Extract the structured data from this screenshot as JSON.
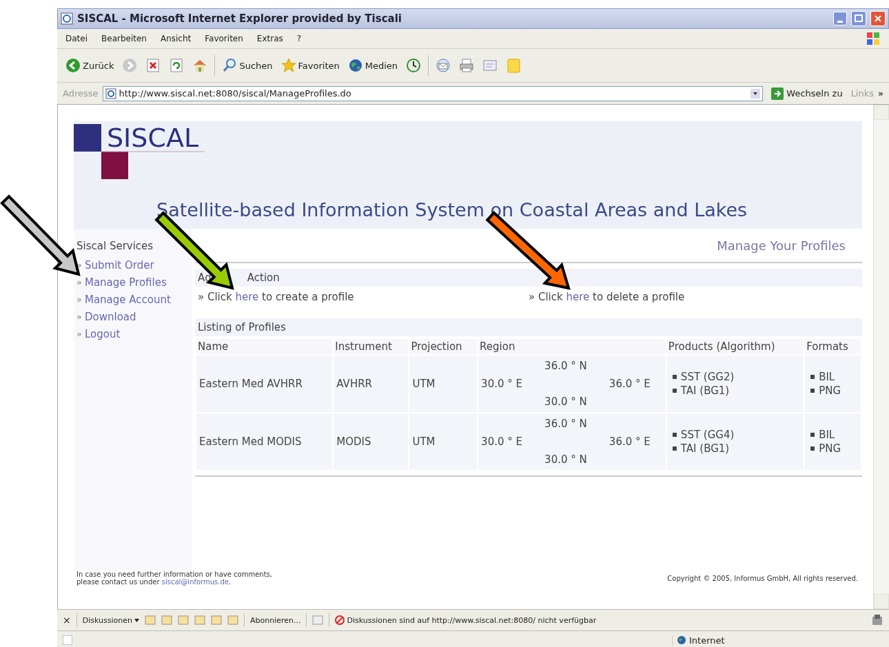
{
  "window": {
    "title": "SISCAL - Microsoft Internet Explorer provided by Tiscali"
  },
  "menu": [
    "Datei",
    "Bearbeiten",
    "Ansicht",
    "Favoriten",
    "Extras",
    "?"
  ],
  "toolbar": [
    {
      "kind": "back",
      "label": "Zurück"
    },
    {
      "kind": "forward"
    },
    {
      "kind": "stop"
    },
    {
      "kind": "refresh"
    },
    {
      "kind": "home"
    },
    {
      "kind": "search",
      "label": "Suchen"
    },
    {
      "kind": "favorites",
      "label": "Favoriten"
    },
    {
      "kind": "media",
      "label": "Medien"
    },
    {
      "kind": "history"
    },
    {
      "kind": "mail"
    },
    {
      "kind": "print"
    },
    {
      "kind": "edit"
    },
    {
      "kind": "note"
    }
  ],
  "address": {
    "label": "Adresse",
    "value": "http://www.siscal.net:8080/siscal/ManageProfiles.do",
    "go": "Wechseln zu",
    "links": "Links",
    "more": "»"
  },
  "page": {
    "logo": "SISCAL",
    "subtitle": "Satellite-based Information System on Coastal Areas and Lakes",
    "sidebar": {
      "heading": "Siscal Services",
      "items": [
        {
          "marker": "»",
          "label": "Submit Order"
        },
        {
          "marker": "»",
          "label": "Manage Profiles"
        },
        {
          "marker": "»",
          "label": "Manage Account"
        },
        {
          "marker": "»",
          "label": "Download"
        },
        {
          "marker": "»",
          "label": "Logout"
        }
      ]
    },
    "heading": "Manage Your Profiles",
    "action_heading": [
      "Ag",
      "Action"
    ],
    "actions": [
      {
        "prefix": "» Click",
        "link": "here",
        "suffix": "to create a profile"
      },
      {
        "prefix": "» Click",
        "link": "here",
        "suffix": "to delete a profile"
      }
    ],
    "listing_heading": "Listing of Profiles",
    "columns": [
      "Name",
      "Instrument",
      "Projection",
      "Region",
      "Products (Algorithm)",
      "Formats"
    ],
    "rows": [
      {
        "name": "Eastern Med AVHRR",
        "instrument": "AVHRR",
        "projection": "UTM",
        "region": {
          "north": "36.0 ° N",
          "west": "30.0 ° E",
          "east": "36.0 ° E",
          "south": "30.0 ° N"
        },
        "products": [
          "SST (GG2)",
          "TAI (BG1)"
        ],
        "formats": [
          "BIL",
          "PNG"
        ]
      },
      {
        "name": "Eastern Med MODIS",
        "instrument": "MODIS",
        "projection": "UTM",
        "region": {
          "north": "36.0 ° N",
          "west": "30.0 ° E",
          "east": "36.0 ° E",
          "south": "30.0 ° N"
        },
        "products": [
          "SST (GG4)",
          "TAI (BG1)"
        ],
        "formats": [
          "BIL",
          "PNG"
        ]
      }
    ],
    "footer": {
      "line1": "In case you need further information or have comments,",
      "line2": "please contact us under",
      "email": "siscal@informus.de",
      "end": ".",
      "copyright": "Copyright © 2005, Informus GmbH, All rights reserved."
    }
  },
  "discussion_bar": {
    "close": "×",
    "menu": "Diskussionen",
    "subscribe": "Abonnieren...",
    "message": "Diskussionen sind auf http://www.siscal.net:8080/ nicht verfügbar"
  },
  "status_bar": {
    "zone": "Internet"
  },
  "annotations": [
    {
      "kind": "arrow",
      "color": "#c8c8c8"
    },
    {
      "kind": "arrow",
      "color": "#99cc00"
    },
    {
      "kind": "arrow",
      "color": "#ff6600"
    }
  ]
}
